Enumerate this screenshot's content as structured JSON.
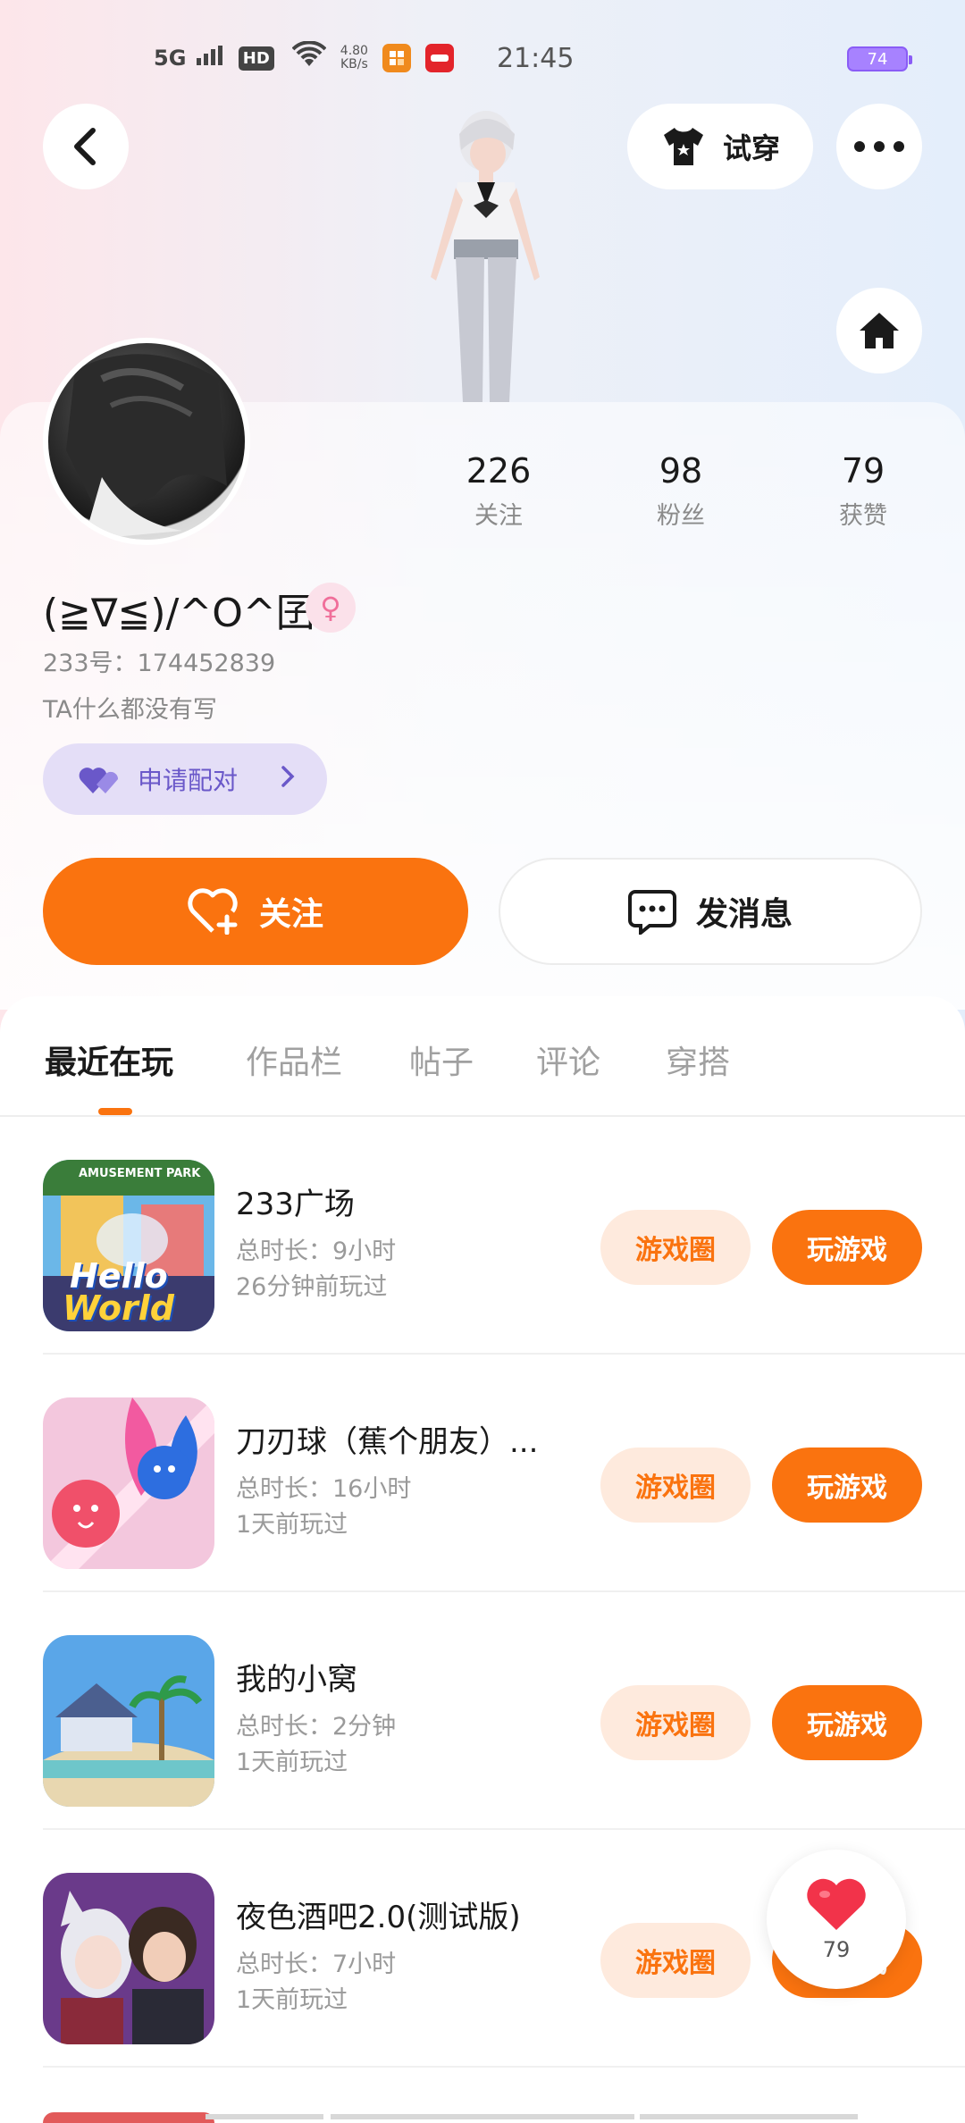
{
  "status_bar": {
    "network": "5G",
    "hd": "HD",
    "speed_value": "4.80",
    "speed_unit": "KB/s",
    "time": "21:45",
    "battery": "74"
  },
  "header": {
    "try_on_label": "试穿"
  },
  "profile": {
    "nickname": "(≧∇≦)/^O^囝",
    "gender_symbol": "♀",
    "uid": "233号：174452839",
    "bio": "TA什么都没有写",
    "pair_label": "申请配对",
    "stats": [
      {
        "value": "226",
        "label": "关注"
      },
      {
        "value": "98",
        "label": "粉丝"
      },
      {
        "value": "79",
        "label": "获赞"
      }
    ]
  },
  "actions": {
    "follow_label": "关注",
    "message_label": "发消息"
  },
  "tabs": [
    "最近在玩",
    "作品栏",
    "帖子",
    "评论",
    "穿搭"
  ],
  "games": [
    {
      "title": "233广场",
      "duration": "总时长：9小时",
      "last_played": "26分钟前玩过",
      "thumb_text_1": "Hello",
      "thumb_text_2": "World",
      "thumb_sign": "AMUSEMENT PARK"
    },
    {
      "title": "刀刃球（蕉个朋友）...",
      "duration": "总时长：16小时",
      "last_played": "1天前玩过"
    },
    {
      "title": "我的小窝",
      "duration": "总时长：2分钟",
      "last_played": "1天前玩过"
    },
    {
      "title": "夜色酒吧2.0(测试版)",
      "duration": "总时长：7小时",
      "last_played": "1天前玩过"
    }
  ],
  "game_buttons": {
    "circle_label": "游戏圈",
    "play_label": "玩游戏"
  },
  "like_fab": {
    "count": "79"
  }
}
